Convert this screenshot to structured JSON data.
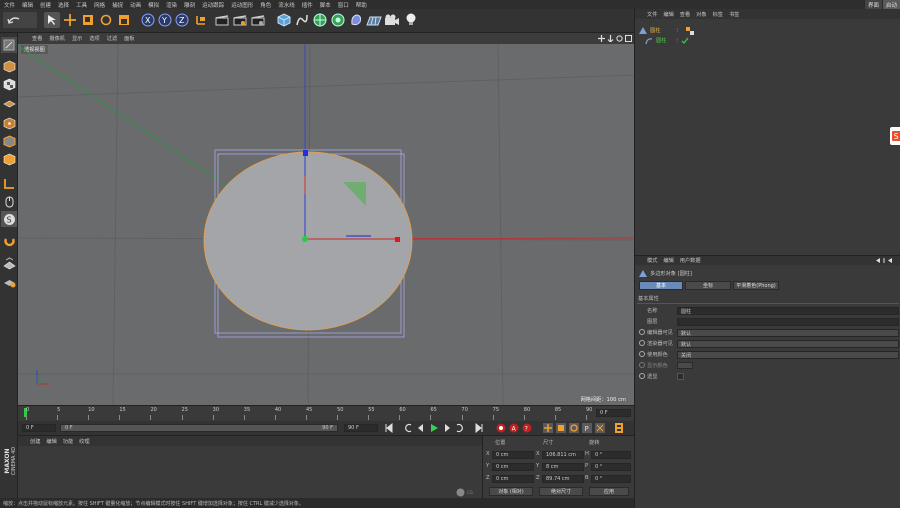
{
  "menu": [
    "文件",
    "编辑",
    "创建",
    "选择",
    "工具",
    "网格",
    "捕捉",
    "动画",
    "模拟",
    "渲染",
    "雕刻",
    "运动跟踪",
    "运动图形",
    "角色",
    "流水线",
    "插件",
    "脚本",
    "窗口",
    "帮助"
  ],
  "layout_tabs": [
    "界面",
    "启动"
  ],
  "viewport": {
    "menu": [
      "查看",
      "摄像机",
      "显示",
      "选项",
      "过滤",
      "面板"
    ],
    "camera_label": "透视视图",
    "grid_spacing": "网格间距：100 cm"
  },
  "timeline": {
    "ticks": [
      "0",
      "5",
      "10",
      "15",
      "20",
      "25",
      "30",
      "35",
      "40",
      "45",
      "50",
      "55",
      "60",
      "65",
      "70",
      "75",
      "80",
      "85",
      "90"
    ],
    "current_frame": "0 F",
    "start_frame": "0 F",
    "preview_start": "0 F",
    "preview_end": "90 F",
    "end_frame": "90 F"
  },
  "materials": {
    "menu": [
      "创建",
      "编辑",
      "功能",
      "纹理"
    ]
  },
  "coords": {
    "headers": {
      "position": "位置",
      "size": "尺寸",
      "rotation": "旋转"
    },
    "rows": [
      {
        "axis": "X",
        "pos": "0 cm",
        "size_axis": "X",
        "size": "106.811 cm",
        "rot_axis": "H",
        "rot": "0 °"
      },
      {
        "axis": "Y",
        "pos": "0 cm",
        "size_axis": "Y",
        "size": "8 cm",
        "rot_axis": "P",
        "rot": "0 °"
      },
      {
        "axis": "Z",
        "pos": "0 cm",
        "size_axis": "Z",
        "size": "89.74 cm",
        "rot_axis": "B",
        "rot": "0 °"
      }
    ],
    "mode_object": "对象 (相对)",
    "mode_size": "绝对尺寸",
    "apply": "应用"
  },
  "status": "缩放：点击并拖动鼠标缩放元素。按住 SHIFT 键量化缩放；节点编辑模式时按住 SHIFT 键增加选择对象；按住 CTRL 键减少选择对象。",
  "brand": {
    "line1": "MAXON",
    "line2": "CINEMA 4D"
  },
  "object_manager": {
    "menu": [
      "文件",
      "编辑",
      "查看",
      "对象",
      "标签",
      "书签"
    ],
    "objects": [
      {
        "name": "圆柱",
        "color": "#e8b34a"
      },
      {
        "name": "圆柱",
        "color": "#4ad04a"
      }
    ]
  },
  "attribute_manager": {
    "menu": [
      "模式",
      "编辑",
      "用户数据"
    ],
    "object_title": "多边形对象 [圆柱]",
    "tabs": [
      "基本",
      "坐标",
      "平滑着色(Phong)"
    ],
    "section": "基本属性",
    "fields": [
      {
        "label": "名称",
        "value": "圆柱"
      },
      {
        "label": "图层",
        "value": ""
      },
      {
        "label": "编辑器可见",
        "value": "默认"
      },
      {
        "label": "渲染器可见",
        "value": "默认"
      },
      {
        "label": "使用颜色",
        "value": "关闭"
      },
      {
        "label": "显示颜色",
        "value": ""
      },
      {
        "label": "透显",
        "value": ""
      }
    ]
  },
  "colors": {
    "accent": "#f0a030",
    "axis_x": "#d02020",
    "axis_y": "#2050e0",
    "axis_z": "#2ab04a"
  }
}
